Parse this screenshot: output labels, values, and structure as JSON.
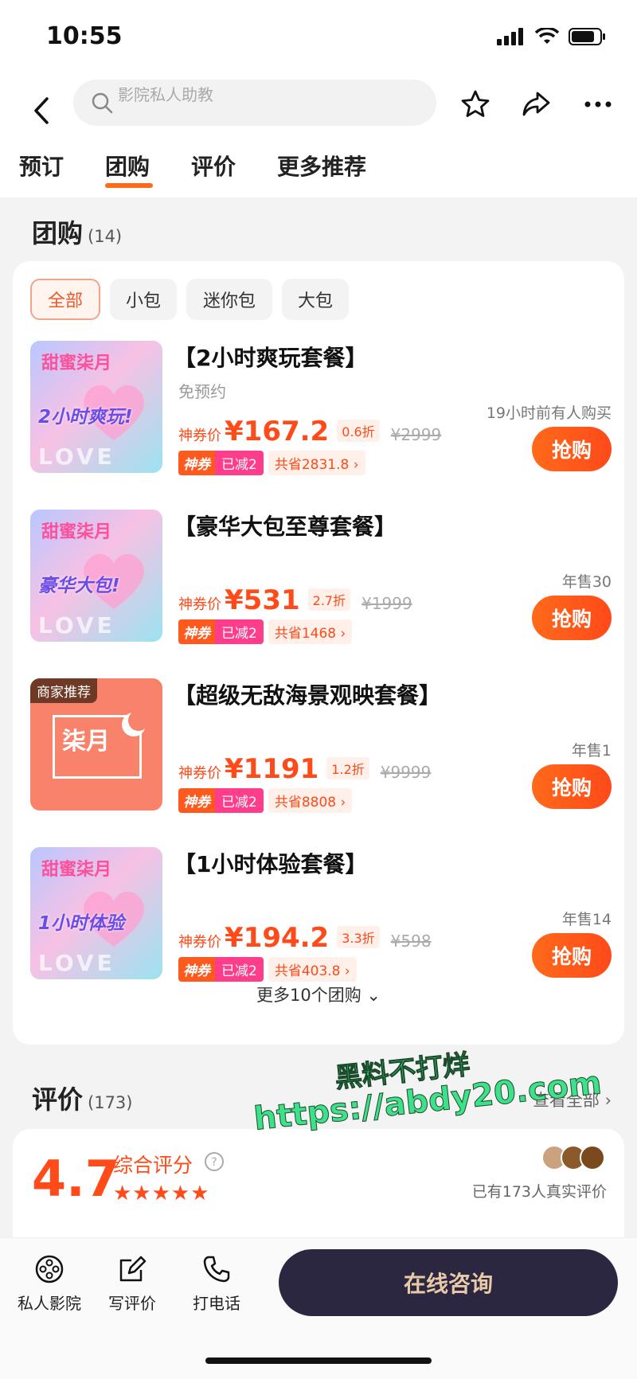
{
  "status": {
    "time": "10:55"
  },
  "nav": {
    "search_placeholder": "影院私人助教"
  },
  "tabs": [
    {
      "label": "预订"
    },
    {
      "label": "团购"
    },
    {
      "label": "评价"
    },
    {
      "label": "更多推荐"
    }
  ],
  "group_buy": {
    "title": "团购",
    "count": "(14)",
    "filters": [
      {
        "label": "全部"
      },
      {
        "label": "小包"
      },
      {
        "label": "迷你包"
      },
      {
        "label": "大包"
      }
    ],
    "deals": [
      {
        "title": "【2小时爽玩套餐】",
        "subtitle": "免预约",
        "image_brand": "甜蜜柒月",
        "image_tag": "2小时爽玩!",
        "price_label": "神券价",
        "price": "¥167.2",
        "discount": "0.6折",
        "original_price": "¥2999",
        "promo_tag": "神券",
        "promo_save": "已减2",
        "promo_total": "共省2831.8 ›",
        "sales": "19小时前有人购买",
        "buy_label": "抢购"
      },
      {
        "title": "【豪华大包至尊套餐】",
        "subtitle": "",
        "image_brand": "甜蜜柒月",
        "image_tag": "豪华大包!",
        "price_label": "神券价",
        "price": "¥531",
        "discount": "2.7折",
        "original_price": "¥1999",
        "promo_tag": "神券",
        "promo_save": "已减2",
        "promo_total": "共省1468 ›",
        "sales": "年售30",
        "buy_label": "抢购"
      },
      {
        "title": "【超级无敌海景观映套餐】",
        "subtitle": "",
        "merchant_badge": "商家推荐",
        "image_brand": "柒月",
        "price_label": "神券价",
        "price": "¥1191",
        "discount": "1.2折",
        "original_price": "¥9999",
        "promo_tag": "神券",
        "promo_save": "已减2",
        "promo_total": "共省8808 ›",
        "sales": "年售1",
        "buy_label": "抢购"
      },
      {
        "title": "【1小时体验套餐】",
        "subtitle": "",
        "image_brand": "甜蜜柒月",
        "image_tag": "1小时体验",
        "price_label": "神券价",
        "price": "¥194.2",
        "discount": "3.3折",
        "original_price": "¥598",
        "promo_tag": "神券",
        "promo_save": "已减2",
        "promo_total": "共省403.8 ›",
        "sales": "年售14",
        "buy_label": "抢购"
      }
    ],
    "more_label": "更多10个团购 ⌄"
  },
  "reviews": {
    "title": "评价",
    "count": "(173)",
    "view_all": "查看全部 ›",
    "score": "4.7",
    "score_label": "综合评分",
    "stars": "★★★★★",
    "review_count_text": "已有173人真实评价"
  },
  "watermark": {
    "line1": "黑料不打烊",
    "line2": "https://abdy20.com"
  },
  "bottom_bar": {
    "items": [
      {
        "label": "私人影院",
        "icon": "film-reel-icon"
      },
      {
        "label": "写评价",
        "icon": "edit-icon"
      },
      {
        "label": "打电话",
        "icon": "phone-icon"
      }
    ],
    "consult_label": "在线咨询"
  },
  "colors": {
    "accent": "#ff4a1a",
    "consult_bg": "#2b2740"
  }
}
